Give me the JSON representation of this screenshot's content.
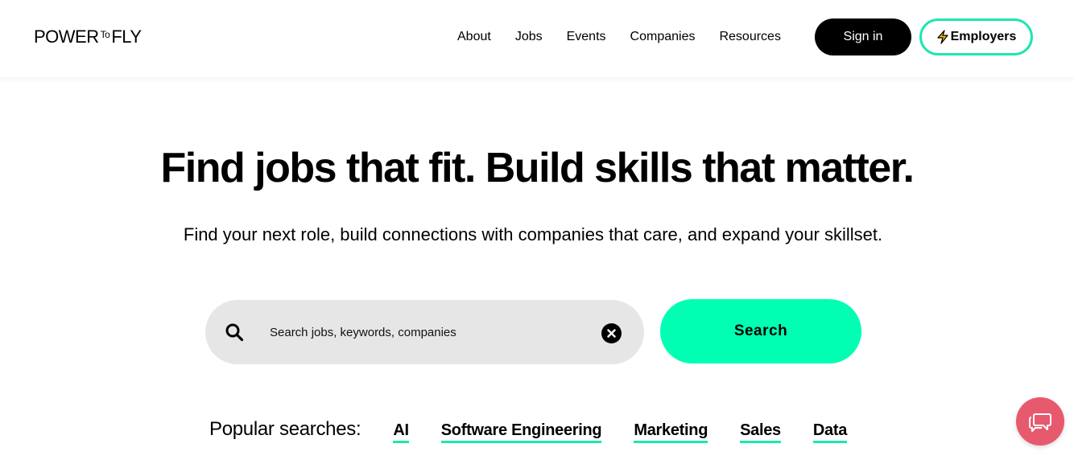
{
  "header": {
    "logo": {
      "part1": "POWER",
      "part2": "To",
      "part3": "FLY"
    },
    "nav": [
      "About",
      "Jobs",
      "Events",
      "Companies",
      "Resources"
    ],
    "signin_label": "Sign in",
    "employers_label": "Employers",
    "employers_icon": "lightning-bolt-icon"
  },
  "hero": {
    "headline": "Find jobs that fit. Build skills that matter.",
    "subline": "Find your next role, build connections with companies that care, and expand your skillset."
  },
  "search": {
    "placeholder": "Search jobs, keywords, companies",
    "value": "",
    "button_label": "Search",
    "search_icon": "search-icon",
    "clear_icon": "clear-icon"
  },
  "popular": {
    "label": "Popular searches:",
    "items": [
      "AI",
      "Software Engineering",
      "Marketing",
      "Sales",
      "Data"
    ]
  },
  "chat": {
    "icon": "chat-icon"
  },
  "colors": {
    "accent": "#00ffb3",
    "accent_border": "#1ee6b0",
    "chat": "#e75a6e",
    "search_bg": "#e6e6e6"
  }
}
